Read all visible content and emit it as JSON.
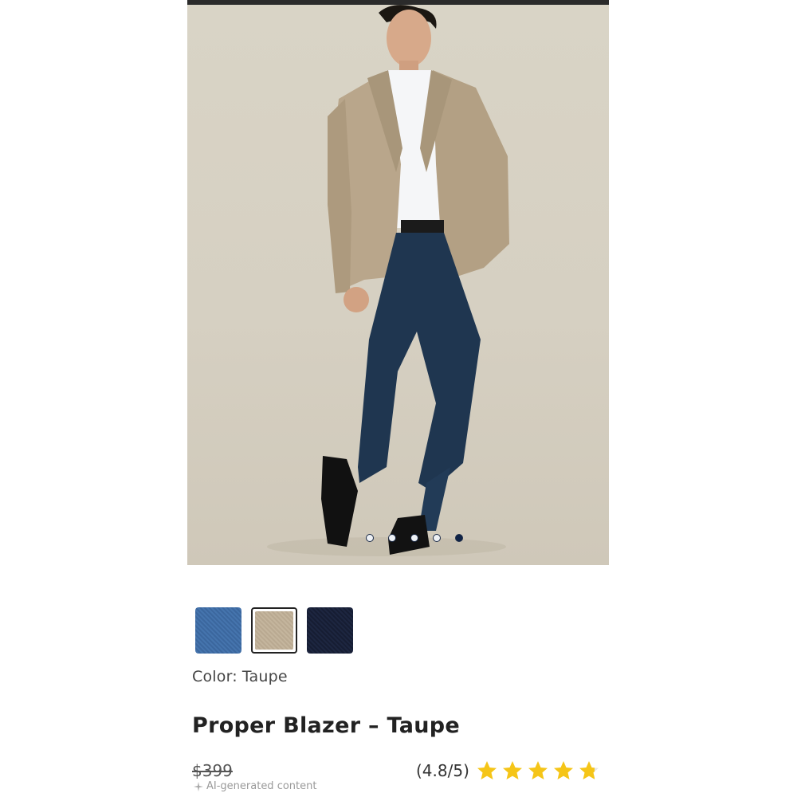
{
  "gallery": {
    "image_alt": "Model wearing the Proper Blazer in Taupe with navy trousers",
    "slide_count": 5,
    "active_slide": 5
  },
  "swatches": [
    {
      "name": "Blue",
      "color": "#3f6da7"
    },
    {
      "name": "Taupe",
      "color": "#bfae95",
      "selected": true
    },
    {
      "name": "Navy",
      "color": "#1a2139"
    }
  ],
  "color_selection": {
    "label": "Color:",
    "value": "Taupe"
  },
  "product": {
    "title": "Proper Blazer – Taupe",
    "price": "$399",
    "ai_note": "AI-generated content"
  },
  "rating": {
    "text": "(4.8/5)",
    "value": 4.8,
    "max": 5,
    "star_color": "#f5c518"
  },
  "colors": {
    "accent": "#0f2347"
  }
}
